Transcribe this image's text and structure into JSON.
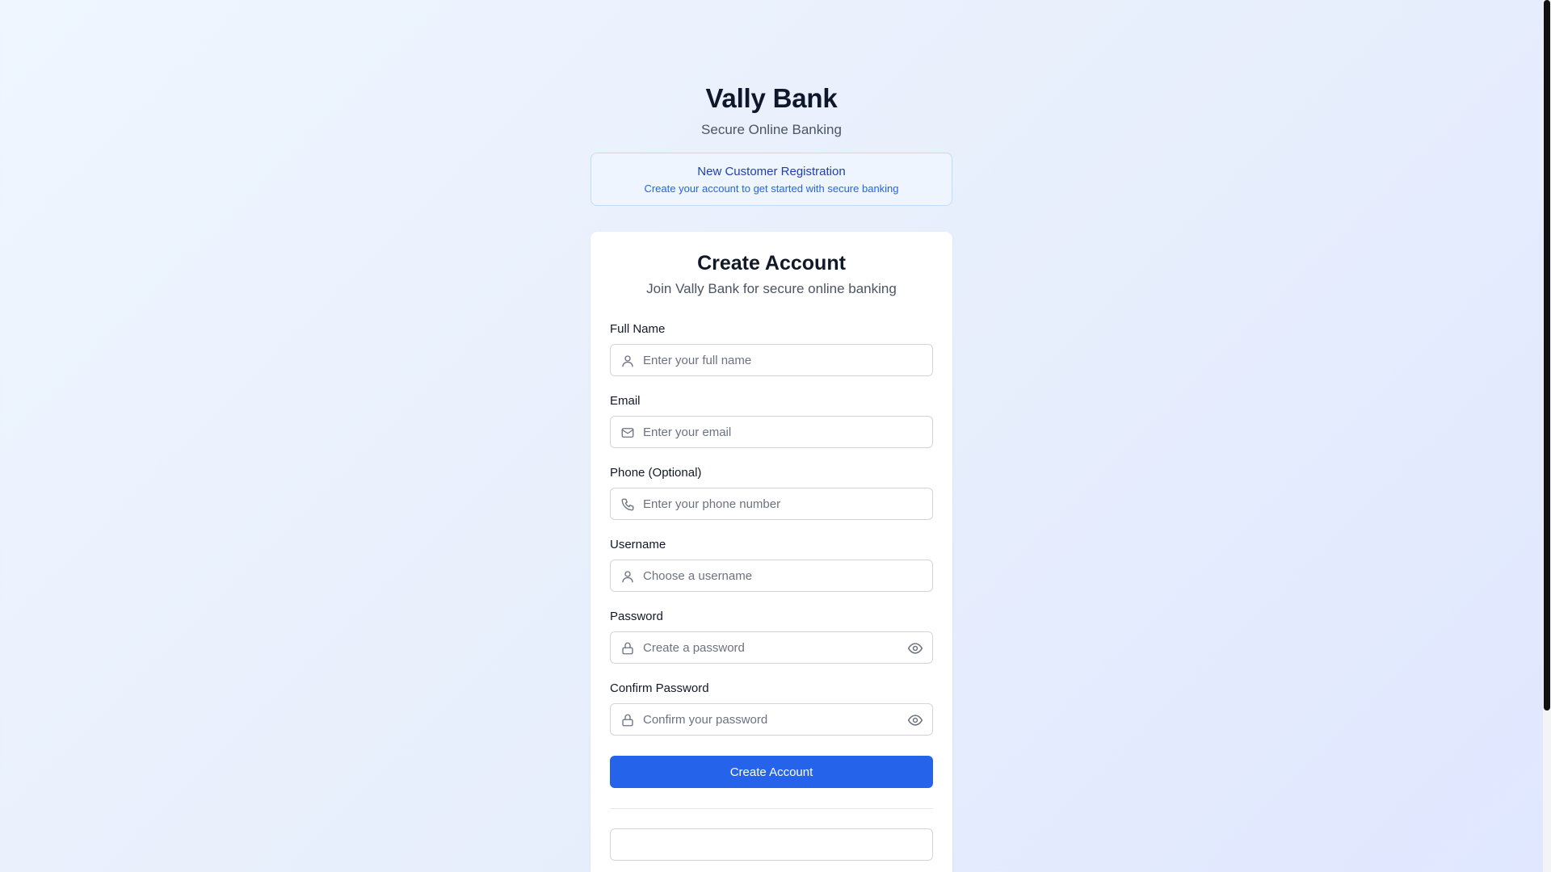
{
  "header": {
    "title": "Vally Bank",
    "subtitle": "Secure Online Banking"
  },
  "notice": {
    "title": "New Customer Registration",
    "text": "Create your account to get started with secure banking"
  },
  "card": {
    "title": "Create Account",
    "subtitle": "Join Vally Bank for secure online banking"
  },
  "form": {
    "fields": [
      {
        "label": "Full Name",
        "placeholder": "Enter your full name",
        "icon": "user-icon",
        "value": ""
      },
      {
        "label": "Email",
        "placeholder": "Enter your email",
        "icon": "mail-icon",
        "value": ""
      },
      {
        "label": "Phone (Optional)",
        "placeholder": "Enter your phone number",
        "icon": "phone-icon",
        "value": ""
      },
      {
        "label": "Username",
        "placeholder": "Choose a username",
        "icon": "user-icon",
        "value": ""
      },
      {
        "label": "Password",
        "placeholder": "Create a password",
        "icon": "lock-icon",
        "toggle_icon": "eye-icon",
        "value": ""
      },
      {
        "label": "Confirm Password",
        "placeholder": "Confirm your password",
        "icon": "lock-icon",
        "toggle_icon": "eye-icon",
        "value": ""
      }
    ],
    "submit_label": "Create Account"
  },
  "colors": {
    "primary": "#2563eb",
    "notice_border": "#bfdbfe",
    "notice_title": "#1e40af",
    "background": "#eff6ff"
  }
}
